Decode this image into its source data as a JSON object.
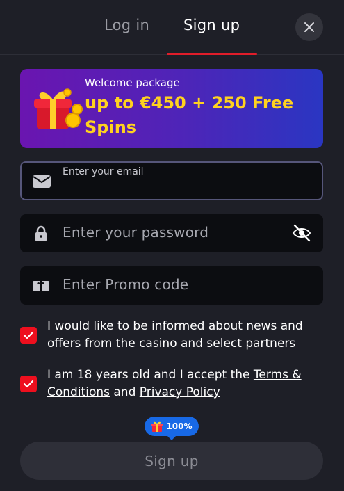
{
  "tabs": {
    "login": "Log in",
    "signup": "Sign up"
  },
  "banner": {
    "small": "Welcome package",
    "big": "up to €450 + 250 Free Spins"
  },
  "fields": {
    "email_label": "Enter your email",
    "password_placeholder": "Enter your password",
    "promo_placeholder": "Enter Promo code"
  },
  "checks": {
    "news": "I would like to be informed about news and offers from the casino and select partners",
    "age_prefix": "I am 18 years old and I accept the ",
    "terms_link": "Terms & Conditions",
    "and": " and ",
    "privacy_link": "Privacy Policy"
  },
  "badge": {
    "text": "100%"
  },
  "submit": {
    "label": "Sign up"
  },
  "colors": {
    "accent": "#e01d2a",
    "checkbox": "#ee0f1e",
    "banner_text": "#ffd21f",
    "badge": "#1869e6"
  }
}
